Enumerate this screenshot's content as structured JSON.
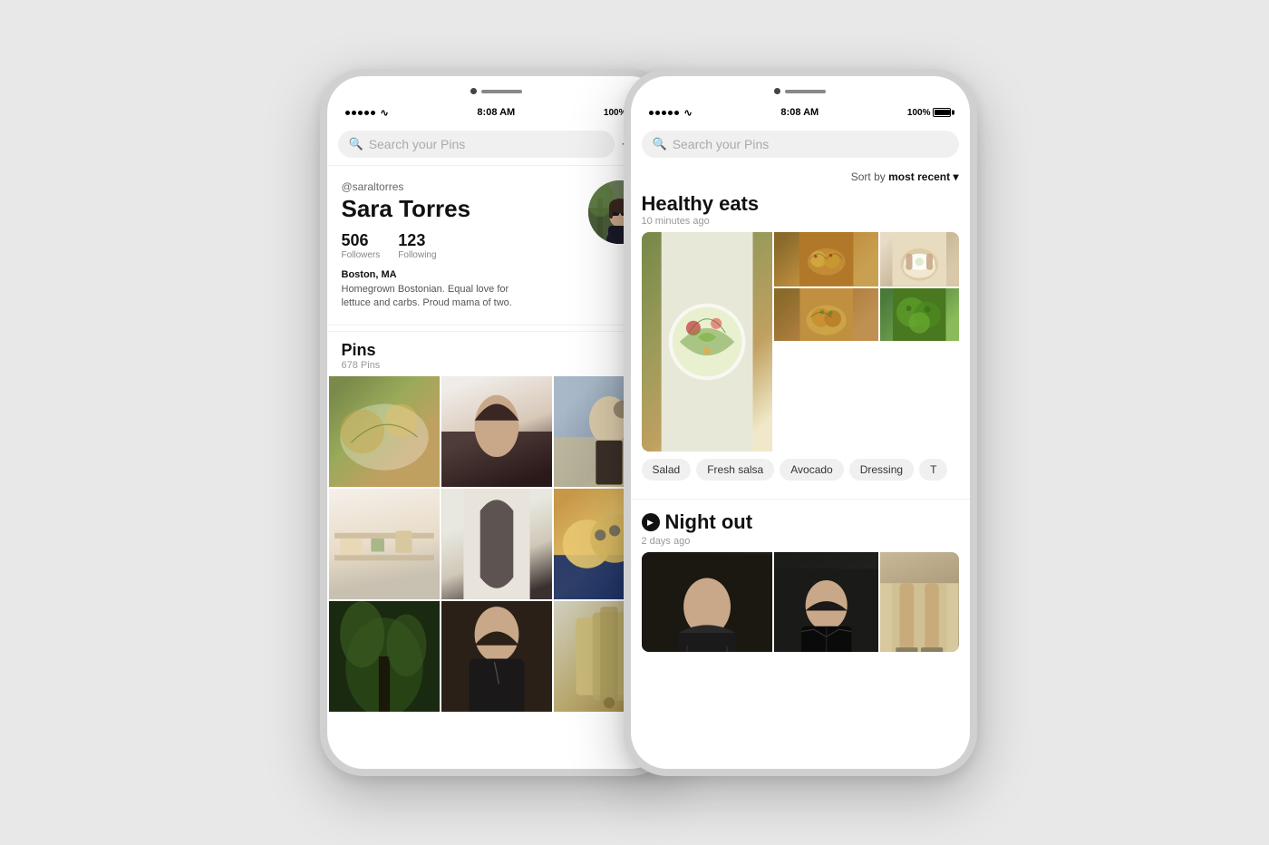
{
  "page": {
    "background": "#e8e8e8"
  },
  "phone_left": {
    "status": {
      "time": "8:08 AM",
      "battery": "100%",
      "dots": 5
    },
    "search": {
      "placeholder": "Search your Pins"
    },
    "profile": {
      "username": "@saraltorres",
      "display_name": "Sara Torres",
      "followers": "506",
      "followers_label": "Followers",
      "following": "123",
      "following_label": "Following",
      "location": "Boston, MA",
      "bio": "Homegrown Bostonian. Equal love for lettuce and carbs. Proud mama of two."
    },
    "pins": {
      "title": "Pins",
      "count": "678 Pins"
    },
    "actions": {
      "add": "+",
      "settings": "⚙"
    }
  },
  "phone_right": {
    "status": {
      "time": "8:08 AM",
      "battery": "100%"
    },
    "search": {
      "placeholder": "Search your Pins"
    },
    "sort": {
      "label": "Sort by",
      "value": "most recent"
    },
    "board1": {
      "title": "Healthy eats",
      "time": "10 minutes ago",
      "tags": [
        "Salad",
        "Fresh salsa",
        "Avocado",
        "Dressing",
        "T"
      ]
    },
    "board2": {
      "title": "Night out",
      "time": "2 days ago"
    }
  }
}
